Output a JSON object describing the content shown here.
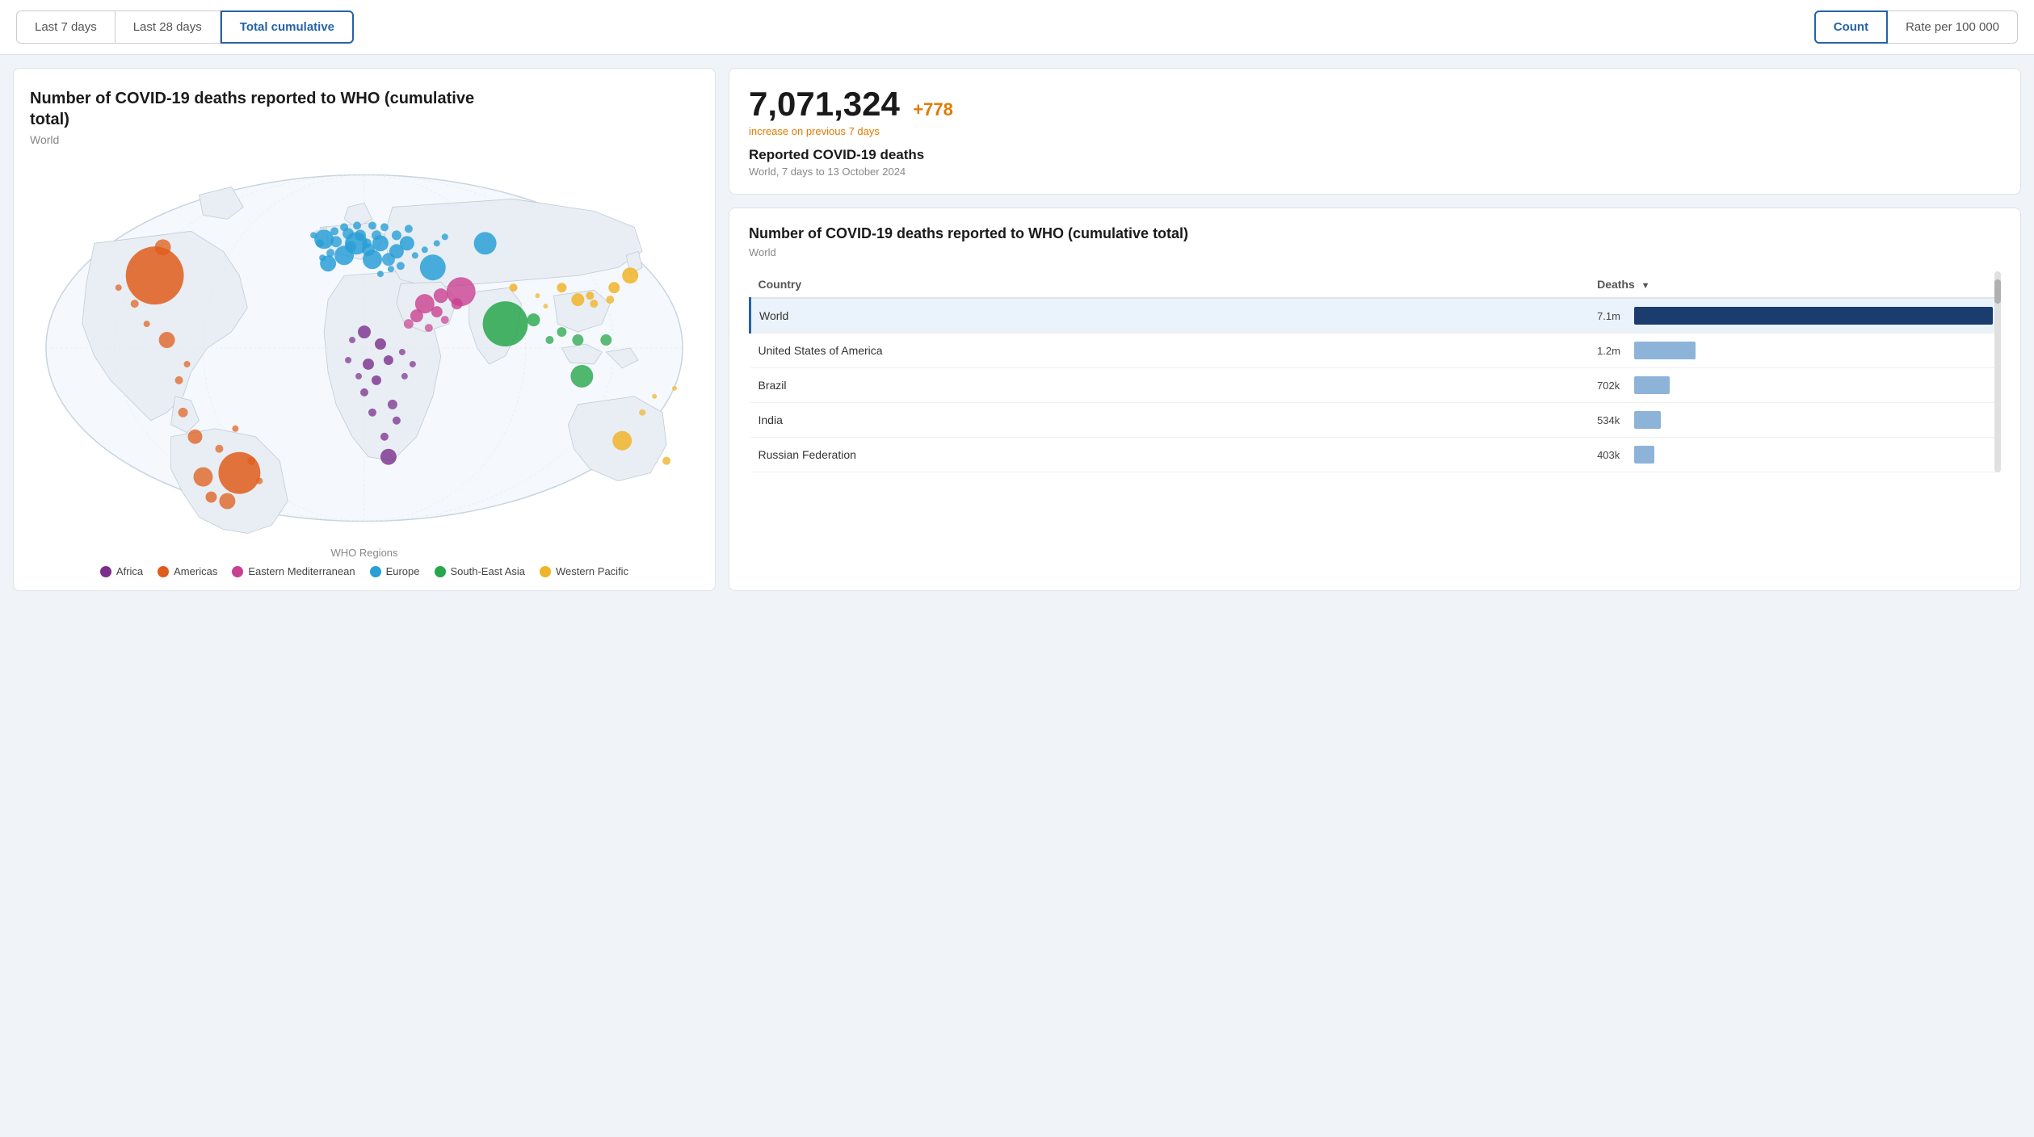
{
  "tabs": {
    "items": [
      {
        "label": "Last 7 days",
        "id": "7days"
      },
      {
        "label": "Last 28 days",
        "id": "28days"
      },
      {
        "label": "Total cumulative",
        "id": "cumulative"
      }
    ],
    "active": "cumulative"
  },
  "toggles": {
    "items": [
      {
        "label": "Count",
        "id": "count"
      },
      {
        "label": "Rate per 100 000",
        "id": "rate"
      }
    ],
    "active": "count"
  },
  "map": {
    "chart_title": "Number of COVID-19 deaths reported to WHO (cumulative total)",
    "chart_subtitle": "World",
    "legend_title": "WHO Regions",
    "legend": [
      {
        "label": "Africa",
        "color": "#7b2d8b"
      },
      {
        "label": "Americas",
        "color": "#e05c1a"
      },
      {
        "label": "Eastern Mediterranean",
        "color": "#c94090"
      },
      {
        "label": "Europe",
        "color": "#2a9fd6"
      },
      {
        "label": "South-East Asia",
        "color": "#27a64b"
      },
      {
        "label": "Western Pacific",
        "color": "#f0b429"
      }
    ]
  },
  "stats": {
    "big_number": "7,071,324",
    "increase": "+778",
    "increase_label": "increase on previous 7 days",
    "label": "Reported COVID-19 deaths",
    "meta": "World, 7 days to 13 October 2024"
  },
  "table": {
    "title": "Number of COVID-19 deaths reported to WHO (cumulative total)",
    "subtitle": "World",
    "col_country": "Country",
    "col_deaths": "Deaths",
    "rows": [
      {
        "country": "World",
        "deaths": "7.1m",
        "bar_pct": 100,
        "bar_color": "#1a3c6e",
        "highlighted": true
      },
      {
        "country": "United States of America",
        "deaths": "1.2m",
        "bar_pct": 17,
        "bar_color": "#8db4d8",
        "highlighted": false
      },
      {
        "country": "Brazil",
        "deaths": "702k",
        "bar_pct": 10,
        "bar_color": "#8db4d8",
        "highlighted": false
      },
      {
        "country": "India",
        "deaths": "534k",
        "bar_pct": 7.5,
        "bar_color": "#8db4d8",
        "highlighted": false
      },
      {
        "country": "Russian Federation",
        "deaths": "403k",
        "bar_pct": 5.7,
        "bar_color": "#8db4d8",
        "highlighted": false
      }
    ]
  }
}
